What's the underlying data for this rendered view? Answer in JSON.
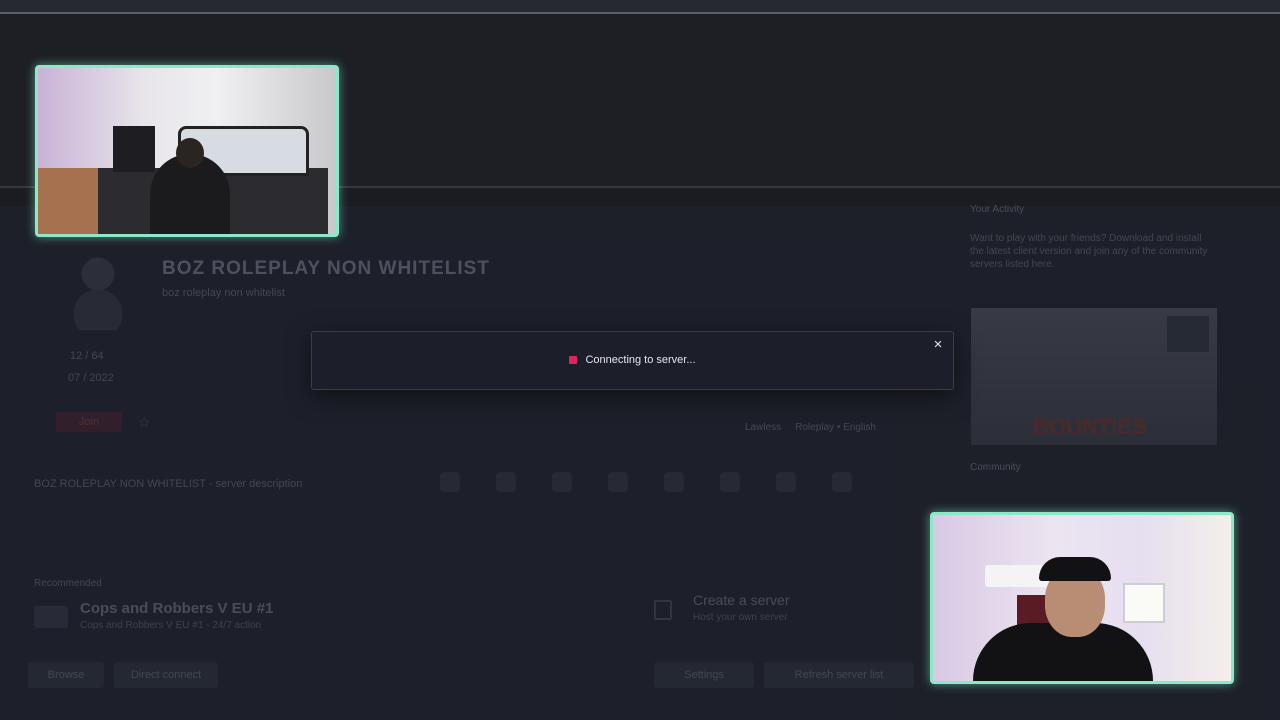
{
  "server": {
    "title": "BOZ ROLEPLAY NON WHITELIST",
    "subtitle": "boz roleplay non whitelist",
    "players": "12 / 64",
    "ping": "07 / 2022",
    "join_label": "Join",
    "description": "BOZ ROLEPLAY NON WHITELIST - server description"
  },
  "sidebar": {
    "heading": "Your Activity",
    "text": "Want to play with your friends? Download and install the latest client version and join any of the community servers listed here.",
    "promo_title": "BOUNTIES",
    "heading2": "Community"
  },
  "list": {
    "section_label": "Recommended",
    "item_title": "Cops and Robbers V EU #1",
    "item_sub": "Cops and Robbers V EU #1 - 24/7 action",
    "create_title": "Create a server",
    "create_sub": "Host your own server"
  },
  "buttons": {
    "bottom_1": "Browse",
    "bottom_2": "Direct connect",
    "bottom_3": "Settings",
    "bottom_4": "Refresh server list"
  },
  "modal": {
    "status_text": "Connecting to server...",
    "close_glyph": "×"
  },
  "tags": {
    "tag_1": "Lawless",
    "tag_2": "Roleplay • English"
  },
  "colors": {
    "accent": "#e0245e",
    "webcam_border": "#8de8c8",
    "modal_bg": "#1c1f29"
  }
}
